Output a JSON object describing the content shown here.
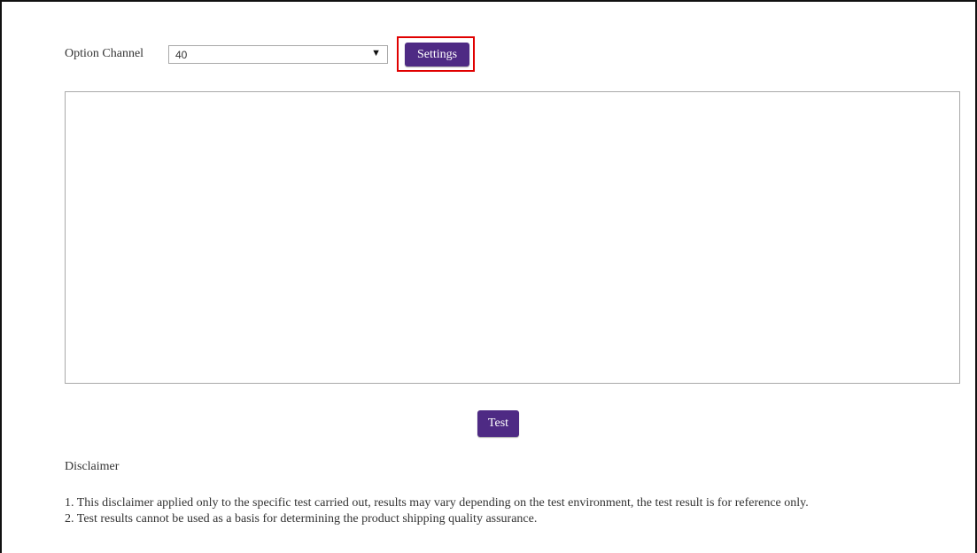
{
  "option_channel": {
    "label": "Option Channel",
    "selected": "40"
  },
  "toolbar": {
    "settings_label": "Settings",
    "highlight_color": "#e00000"
  },
  "output": {
    "value": ""
  },
  "actions": {
    "test_label": "Test"
  },
  "disclaimer": {
    "title": "Disclaimer",
    "lines": [
      "1. This disclaimer applied only to the specific test carried out, results may vary depending on the test environment, the test result is for reference only.",
      "2. Test results cannot be used as a basis for determining the product shipping quality assurance."
    ]
  },
  "colors": {
    "button_bg": "#4e2a84",
    "button_text": "#ffffff",
    "border": "#a9a9a9"
  },
  "icons": {
    "dropdown": "caret-down-icon"
  }
}
